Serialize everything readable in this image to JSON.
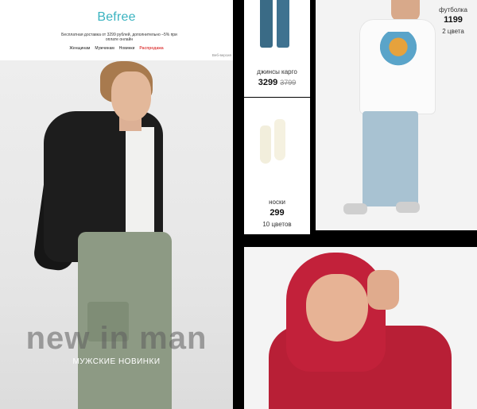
{
  "email": {
    "logo": "Befree",
    "promo": "Бесплатная доставка от 3299 рублей, дополнительно –5% при оплате онлайн",
    "nav": [
      {
        "label": "Женщинам"
      },
      {
        "label": "Мужчинам"
      },
      {
        "label": "Новинки"
      },
      {
        "label": "Распродажа"
      }
    ],
    "web_version": "Веб-версия",
    "hero": {
      "title": "new in man",
      "subtitle": "МУЖСКИЕ НОВИНКИ"
    }
  },
  "products": {
    "jeans": {
      "name": "джинсы карго",
      "price": "3299",
      "old_price": "3799"
    },
    "socks": {
      "name": "носки",
      "price": "299",
      "colors": "10 цветов"
    },
    "tshirt": {
      "name": "футболка",
      "price": "1199",
      "colors": "2 цвета"
    }
  }
}
